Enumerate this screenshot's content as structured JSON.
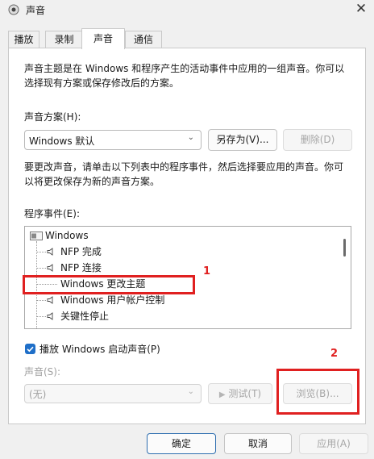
{
  "window": {
    "title": "声音",
    "close_glyph": "✕"
  },
  "tabs": [
    {
      "label": "播放",
      "active": false
    },
    {
      "label": "录制",
      "active": false
    },
    {
      "label": "声音",
      "active": true
    },
    {
      "label": "通信",
      "active": false
    }
  ],
  "intro_text": [
    "声音主题是在 Windows 和程序产生的活动事件中应用的一组声音。你可以",
    "选择现有方案或保存修改后的方案。"
  ],
  "scheme": {
    "label": "声音方案(H):",
    "selected": "Windows 默认",
    "save_as_button": "另存为(V)...",
    "delete_button": "删除(D)"
  },
  "instruction_text": [
    "要更改声音，请单击以下列表中的程序事件，然后选择要应用的声音。你可",
    "以将更改保存为新的声音方案。"
  ],
  "events": {
    "label": "程序事件(E):",
    "root": "Windows",
    "items": [
      {
        "label": "NFP 完成",
        "has_sound": true
      },
      {
        "label": "NFP 连接",
        "has_sound": true
      },
      {
        "label": "Windows 更改主题",
        "has_sound": false
      },
      {
        "label": "Windows 用户帐户控制",
        "has_sound": true
      },
      {
        "label": "关键性停止",
        "has_sound": true
      }
    ]
  },
  "startup_sound": {
    "label": "播放 Windows 启动声音(P)",
    "checked": true
  },
  "sound": {
    "label": "声音(S):",
    "selected": "(无)",
    "test_button": "测试(T)",
    "browse_button": "浏览(B)..."
  },
  "footer": {
    "ok_button": "确定",
    "cancel_button": "取消",
    "apply_button": "应用(A)"
  },
  "annotations": {
    "marker_1": "1",
    "marker_2": "2"
  },
  "colors": {
    "highlight": "#e02020",
    "accent": "#1f6fc8"
  }
}
